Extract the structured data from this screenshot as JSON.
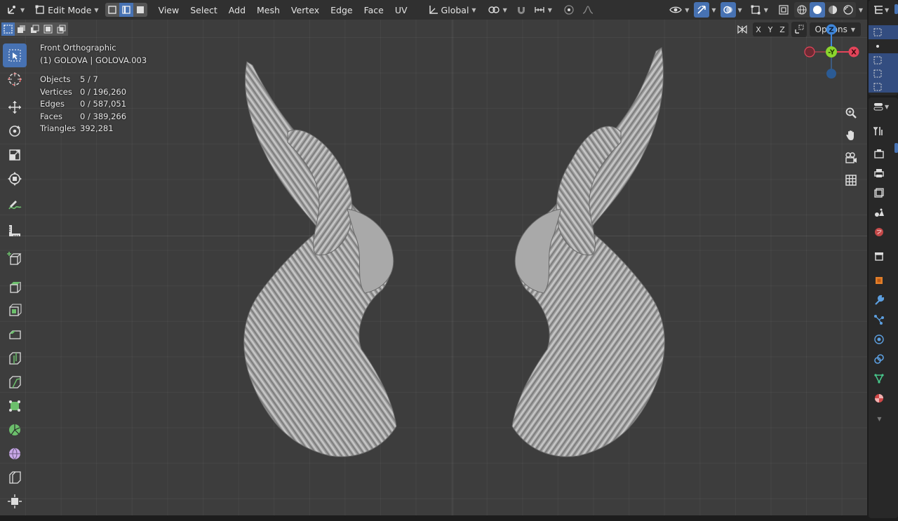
{
  "header": {
    "mode_label": "Edit Mode",
    "menus": [
      "View",
      "Select",
      "Add",
      "Mesh",
      "Vertex",
      "Edge",
      "Face",
      "UV"
    ],
    "transform_orientation": "Global"
  },
  "viewport": {
    "view_name": "Front Orthographic",
    "object_name": "(1) GOLOVA | GOLOVA.003",
    "stats": [
      {
        "label": "Objects",
        "value": "5 / 7"
      },
      {
        "label": "Vertices",
        "value": "0 / 196,260"
      },
      {
        "label": "Edges",
        "value": "0 / 587,051"
      },
      {
        "label": "Faces",
        "value": "0 / 389,266"
      },
      {
        "label": "Triangles",
        "value": "392,281"
      }
    ],
    "mirror_axes": [
      "X",
      "Y",
      "Z"
    ],
    "options_label": "Options",
    "gizmo": {
      "z": "Z",
      "y": "-Y",
      "x": "X"
    }
  },
  "colors": {
    "accent": "#4772b3",
    "axis_x": "#e4455a",
    "axis_y": "#8bd52d",
    "axis_z": "#3f86d9",
    "viewport_bg": "#3d3d3d"
  }
}
